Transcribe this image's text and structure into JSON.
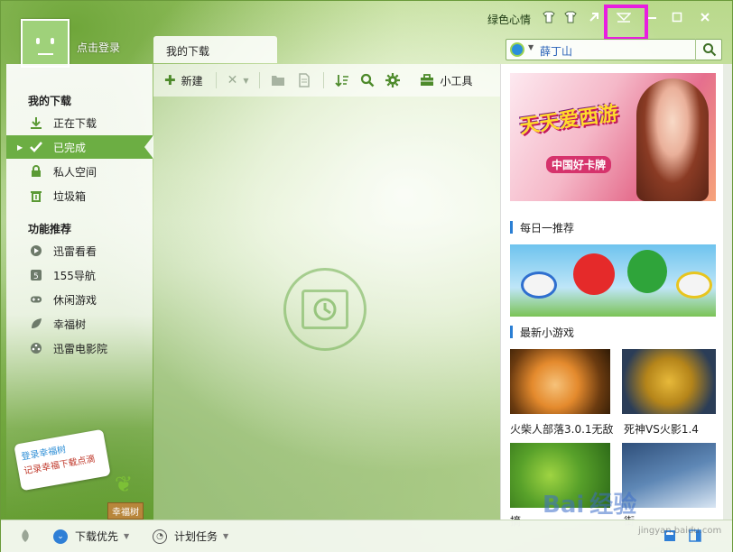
{
  "title_bar": {
    "skin_label": "绿色心情",
    "icons": [
      "skin-icon",
      "shirt-icon",
      "arrow-icon",
      "menu-icon",
      "minimize-icon",
      "maximize-icon",
      "close-icon"
    ]
  },
  "user": {
    "login_text": "点击登录"
  },
  "tabs": [
    {
      "label": "我的下载",
      "active": true
    }
  ],
  "search": {
    "value": "薛丁山",
    "engine_icon": "search-engine-icon"
  },
  "toolbar": {
    "new_label": "新建",
    "tools_label": "小工具"
  },
  "sidebar": {
    "section_downloads": "我的下载",
    "downloads": [
      {
        "label": "正在下载",
        "icon": "download-icon"
      },
      {
        "label": "已完成",
        "icon": "check-icon",
        "active": true
      },
      {
        "label": "私人空间",
        "icon": "lock-icon"
      },
      {
        "label": "垃圾箱",
        "icon": "trash-icon"
      }
    ],
    "section_features": "功能推荐",
    "features": [
      {
        "label": "迅雷看看",
        "icon": "play-icon"
      },
      {
        "label": "155导航",
        "icon": "nav-icon"
      },
      {
        "label": "休闲游戏",
        "icon": "gamepad-icon"
      },
      {
        "label": "幸福树",
        "icon": "leaf-icon"
      },
      {
        "label": "迅雷电影院",
        "icon": "film-icon"
      }
    ]
  },
  "right_panel": {
    "banner_logo": "天天爱西游",
    "banner_sub": "中国好卡牌",
    "daily_title": "每日一推荐",
    "games_title": "最新小游戏",
    "games": [
      {
        "caption": "火柴人部落3.0.1无敌"
      },
      {
        "caption": "死神VS火影1.4"
      },
      {
        "caption": "摘"
      },
      {
        "caption": "街"
      }
    ]
  },
  "happy_tree": {
    "note_line1": "登录幸福树",
    "note_line2": "记录幸福下载点滴",
    "label": "幸福树"
  },
  "status_bar": {
    "priority_label": "下载优先",
    "schedule_label": "计划任务"
  },
  "watermark": {
    "brand": "Bai",
    "brand_cn": "经验",
    "site": "jingyan.baidu.com"
  },
  "colors": {
    "accent": "#6cae43",
    "highlight": "#e81ee0",
    "section_bar": "#2b7fd4"
  }
}
